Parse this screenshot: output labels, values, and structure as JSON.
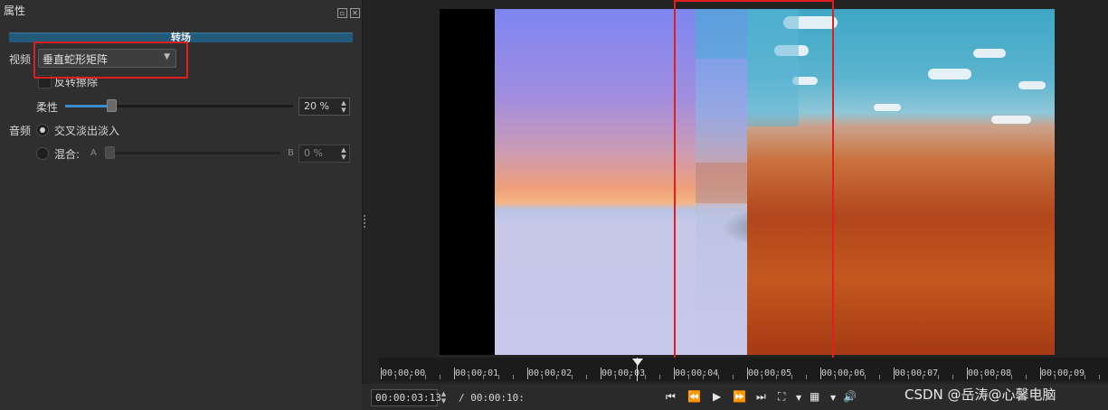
{
  "panel": {
    "title": "属性",
    "transition_label": "转场",
    "video_label": "视频",
    "video_transition": "垂直蛇形矩阵",
    "invert_wipe_label": "反转擦除",
    "softness_label": "柔性",
    "softness_value": "20 %",
    "softness_fraction": 0.2,
    "audio_label": "音频",
    "crossfade_label": "交叉淡出淡入",
    "mix_label": "混合:",
    "mix_a_label": "A",
    "mix_b_label": "B",
    "mix_value": "0 %"
  },
  "timeline": {
    "ticks": [
      "00:00:00",
      "00:00:01",
      "00:00:02",
      "00:00:03",
      "00:00:04",
      "00:00:05",
      "00:00:06",
      "00:00:07",
      "00:00:08",
      "00:00:09"
    ],
    "current_time": "00:00:03:13",
    "duration": "/ 00:00:10:"
  },
  "controls": {
    "skip_start": "⏮",
    "rewind": "⏪",
    "play": "▶",
    "forward": "⏩",
    "skip_end": "⏭",
    "zoom": "⛶",
    "grid": "▦",
    "volume": "🔊"
  },
  "icons": [
    "float-icon",
    "close-icon",
    "dropdown-caret-icon",
    "spin-up-icon",
    "spin-down-icon"
  ],
  "watermark": "CSDN @岳涛@心馨电脑",
  "colors": {
    "accent": "#3b8ed0",
    "transition_bar": "#235a7a",
    "highlight": "#e02020"
  }
}
